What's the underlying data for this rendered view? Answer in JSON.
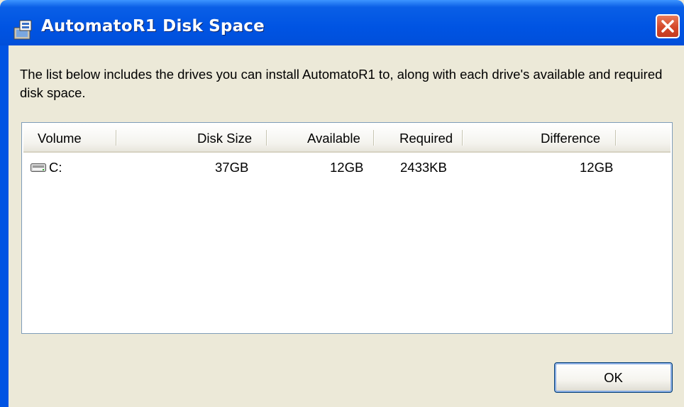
{
  "window": {
    "title": "AutomatoR1 Disk Space"
  },
  "description": "The list below includes the drives you can install AutomatoR1 to, along with each drive's available and required disk space.",
  "table": {
    "columns": [
      "Volume",
      "Disk Size",
      "Available",
      "Required",
      "Difference"
    ],
    "rows": [
      {
        "icon": "hard-drive-icon",
        "volume": "C:",
        "disk_size": "37GB",
        "available": "12GB",
        "required": "2433KB",
        "difference": "12GB"
      }
    ]
  },
  "buttons": {
    "ok": "OK"
  },
  "colors": {
    "titlebar": "#0054e3",
    "close": "#d4482a",
    "dialog_bg": "#ece9d8",
    "list_border": "#7f9db9"
  }
}
